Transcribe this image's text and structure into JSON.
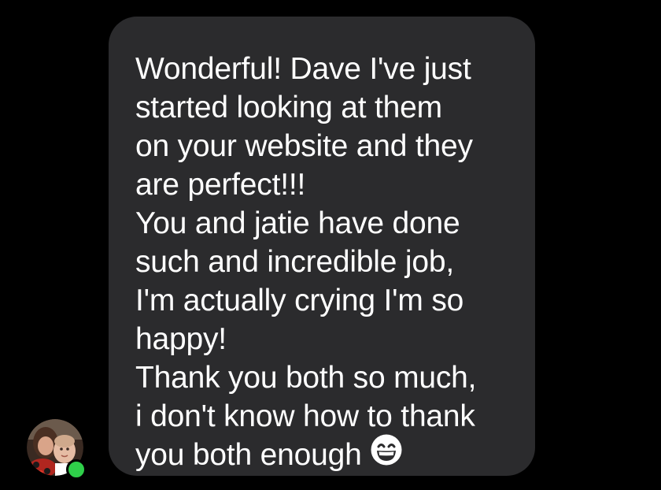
{
  "message": {
    "lines": [
      "Wonderful! Dave I've just",
      "started looking at them",
      "on your website and they",
      "are perfect!!!",
      "You and jatie have done",
      "such and incredible job,",
      "I'm actually crying I'm so",
      "happy!",
      "Thank you both so much,",
      "i don't know how to thank",
      "you both enough"
    ],
    "end_emoji": "grinning-smiling-eyes-emoji"
  },
  "sender": {
    "avatar_icon": "user-avatar",
    "online": true
  },
  "colors": {
    "background": "#000000",
    "bubble": "#2b2b2d",
    "text": "#ffffff",
    "presence": "#2fcf4a"
  }
}
